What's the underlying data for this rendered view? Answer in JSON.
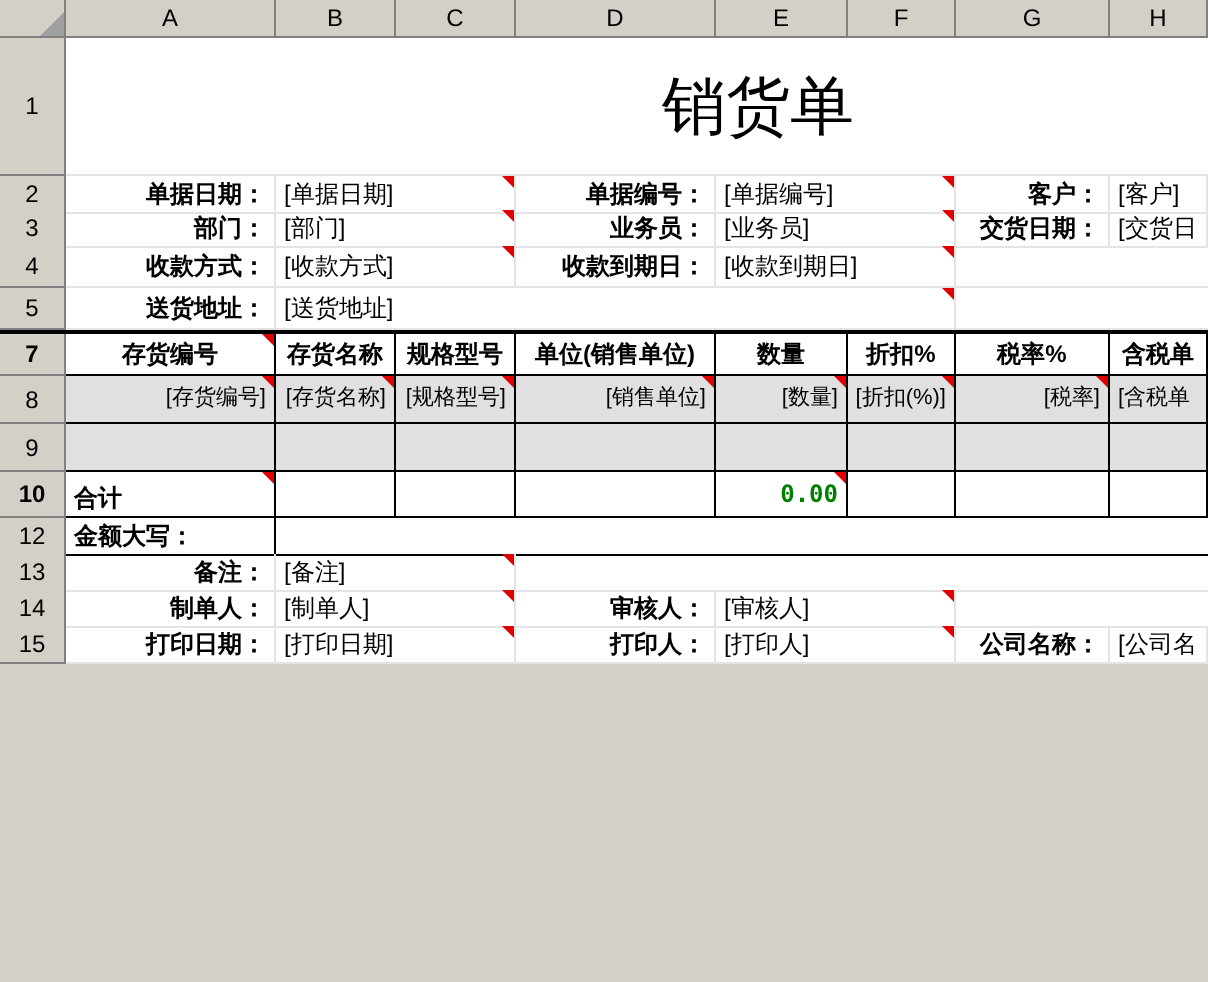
{
  "column_headers": [
    "A",
    "B",
    "C",
    "D",
    "E",
    "F",
    "G",
    "H"
  ],
  "title_row": {
    "row": "1",
    "title": "销货单"
  },
  "header_rows": [
    {
      "row": "2",
      "fields": [
        {
          "label": "单据日期：",
          "value": "[单据日期]",
          "comment": true
        },
        {
          "label": "单据编号：",
          "value": "[单据编号]",
          "comment": true
        },
        {
          "label": "客户：",
          "value": "[客户]",
          "comment": false
        }
      ]
    },
    {
      "row": "3",
      "fields": [
        {
          "label": "部门：",
          "value": "[部门]",
          "comment": true
        },
        {
          "label": "业务员：",
          "value": "[业务员]",
          "comment": true
        },
        {
          "label": "交货日期：",
          "value": "[交货日",
          "comment": false
        }
      ]
    },
    {
      "row": "4",
      "fields": [
        {
          "label": "收款方式：",
          "value": "[收款方式]",
          "comment": true
        },
        {
          "label": "收款到期日：",
          "value": "[收款到期日]",
          "comment": true
        }
      ]
    },
    {
      "row": "5",
      "fields": [
        {
          "label": "送货地址：",
          "value": "[送货地址]",
          "comment": true
        }
      ]
    }
  ],
  "table": {
    "header_row": "7",
    "columns": [
      {
        "label": "存货编号",
        "comment": true
      },
      {
        "label": "存货名称",
        "comment": false
      },
      {
        "label": "规格型号",
        "comment": false
      },
      {
        "label": "单位(销售单位)",
        "comment": false
      },
      {
        "label": "数量",
        "comment": false
      },
      {
        "label": "折扣%",
        "comment": false
      },
      {
        "label": "税率%",
        "comment": false
      },
      {
        "label": "含税单",
        "comment": false
      }
    ],
    "placeholder_row": "8",
    "placeholders": [
      {
        "text": "[存货编号]",
        "comment": true
      },
      {
        "text": "[存货名称]",
        "comment": true
      },
      {
        "text": "[规格型号]",
        "comment": true
      },
      {
        "text": "[销售单位]",
        "comment": true
      },
      {
        "text": "[数量]",
        "comment": true
      },
      {
        "text": "[折扣(%)]",
        "comment": true
      },
      {
        "text": "[税率]",
        "comment": true
      },
      {
        "text": "[含税单",
        "comment": false
      }
    ],
    "blank_row": "9",
    "total_row": {
      "row": "10",
      "label": "合计",
      "label_comment": true,
      "quantity": "0.00",
      "quantity_comment": true
    }
  },
  "amount_row": {
    "row": "12",
    "label": "金额大写："
  },
  "footer_rows": [
    {
      "row": "13",
      "fields": [
        {
          "label": "备注：",
          "value": "[备注]",
          "comment": true
        }
      ]
    },
    {
      "row": "14",
      "fields": [
        {
          "label": "制单人：",
          "value": "[制单人]",
          "comment": true
        },
        {
          "label": "审核人：",
          "value": "[审核人]",
          "comment": true
        }
      ]
    },
    {
      "row": "15",
      "fields": [
        {
          "label": "打印日期：",
          "value": "[打印日期]",
          "comment": true
        },
        {
          "label": "打印人：",
          "value": "[打印人]",
          "comment": true
        },
        {
          "label": "公司名称：",
          "value": "[公司名",
          "comment": false
        }
      ]
    }
  ]
}
